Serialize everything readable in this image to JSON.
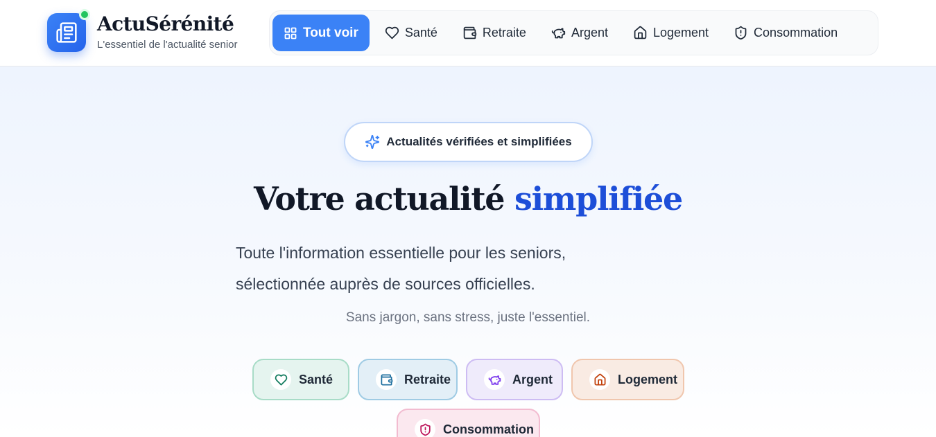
{
  "brand": {
    "name": "ActuSérénité",
    "tagline": "L'essentiel de l'actualité senior"
  },
  "nav": {
    "items": [
      {
        "label": "Tout voir",
        "icon": "grid-icon",
        "active": true
      },
      {
        "label": "Santé",
        "icon": "heart-icon"
      },
      {
        "label": "Retraite",
        "icon": "wallet-icon"
      },
      {
        "label": "Argent",
        "icon": "piggy-bank-icon"
      },
      {
        "label": "Logement",
        "icon": "house-icon"
      },
      {
        "label": "Consommation",
        "icon": "shield-icon"
      }
    ]
  },
  "hero": {
    "badge": "Actualités vérifiées et simplifiées",
    "badge_icon": "sparkles-icon",
    "title_part1": "Votre actualité",
    "title_highlight": "simplifiée",
    "lead_line1": "Toute l'information essentielle pour les seniors,",
    "lead_line2": "sélectionnée auprès de sources officielles.",
    "subtitle": "Sans jargon, sans stress, juste l'essentiel."
  },
  "categories": [
    {
      "label": "Santé",
      "icon": "heart-icon",
      "color": "#0f7a5c"
    },
    {
      "label": "Retraite",
      "icon": "wallet-icon",
      "color": "#1e6f9f"
    },
    {
      "label": "Argent",
      "icon": "piggy-bank-icon",
      "color": "#7c3aed"
    },
    {
      "label": "Logement",
      "icon": "house-icon",
      "color": "#c2410c"
    },
    {
      "label": "Consommation",
      "icon": "shield-icon",
      "color": "#be185d"
    }
  ],
  "colors": {
    "accent": "#3b82f6",
    "title_highlight": "#1d4ed8",
    "online_dot": "#22c55e"
  }
}
